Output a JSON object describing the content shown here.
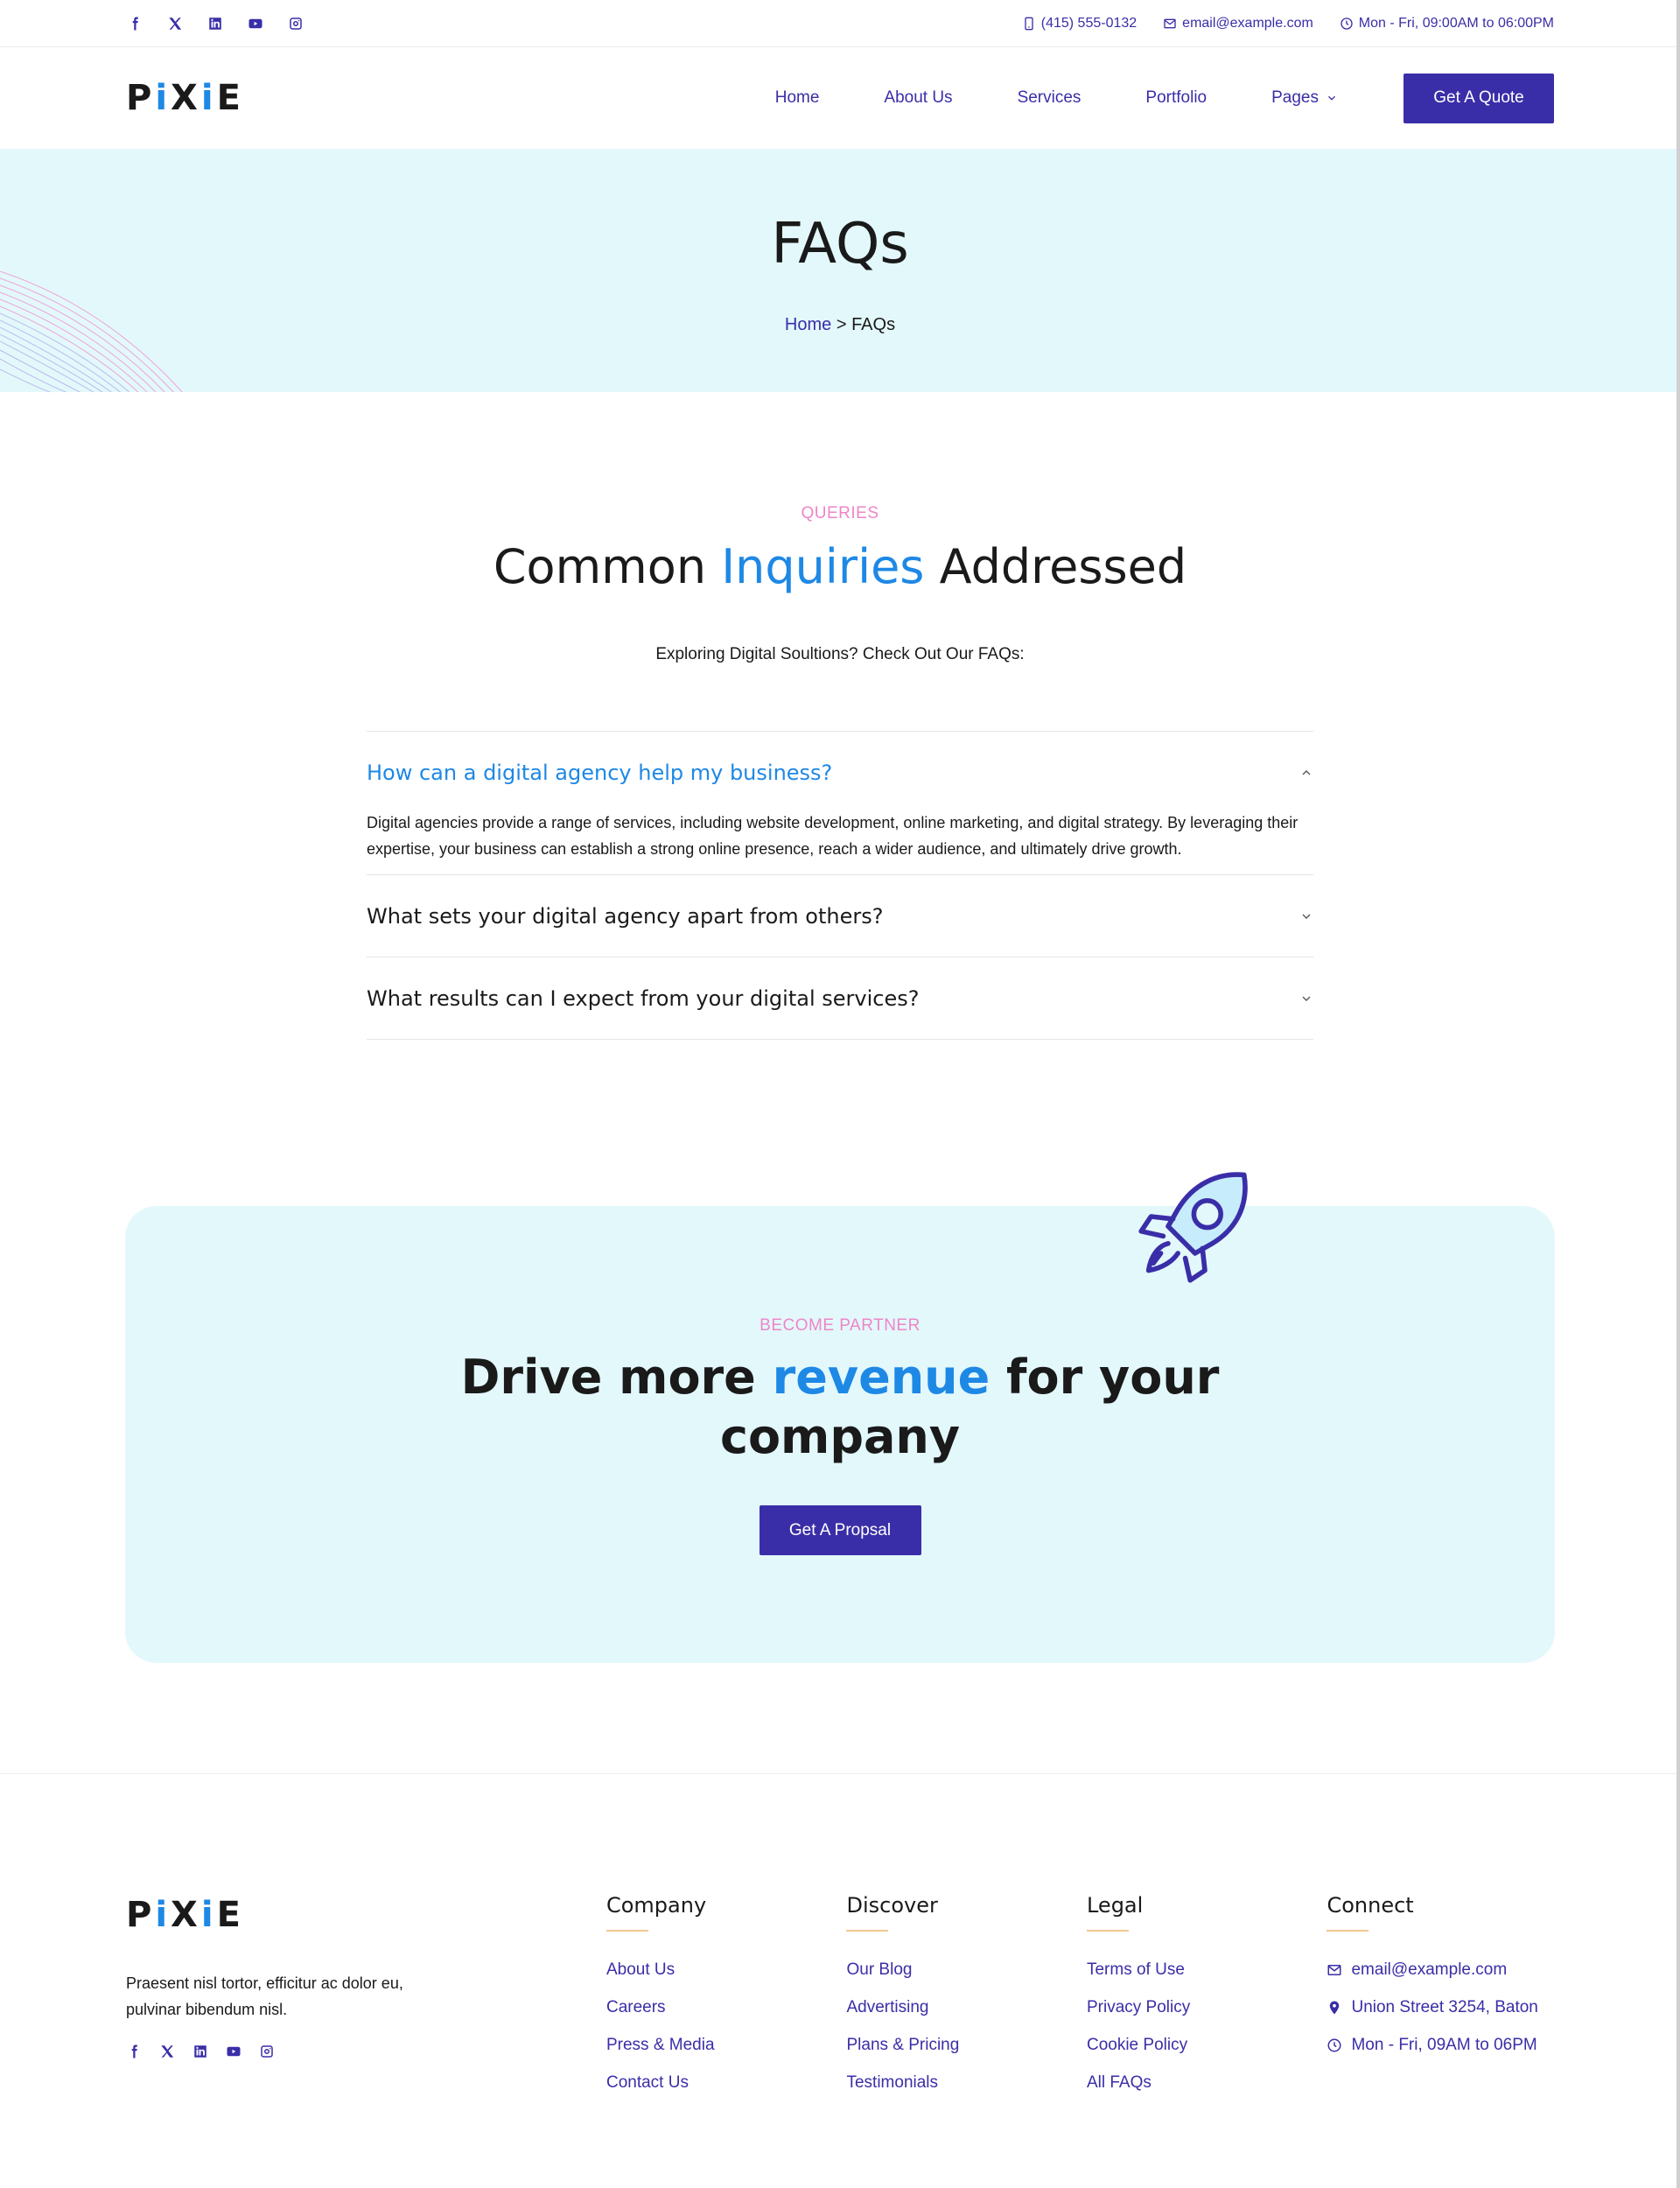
{
  "topbar": {
    "social": [
      "facebook-icon",
      "x-icon",
      "linkedin-icon",
      "youtube-icon",
      "instagram-icon"
    ],
    "phone": "(415) 555-0132",
    "email": "email@example.com",
    "hours": "Mon - Fri, 09:00AM to 06:00PM"
  },
  "header": {
    "logo_pre": "P",
    "logo_i1": "i",
    "logo_mid": "X",
    "logo_i2": "i",
    "logo_post": "E",
    "nav": [
      "Home",
      "About Us",
      "Services",
      "Portfolio",
      "Pages"
    ],
    "cta": "Get A Quote"
  },
  "hero": {
    "title": "FAQs",
    "breadcrumb_home": "Home",
    "breadcrumb_sep": " > ",
    "breadcrumb_current": "FAQs"
  },
  "faq": {
    "eyebrow": "QUERIES",
    "title_pre": "Common ",
    "title_accent": "Inquiries",
    "title_post": " Addressed",
    "subtitle": "Exploring Digital Soultions? Check Out Our FAQs:",
    "items": [
      {
        "question": "How can a digital agency help my business?",
        "answer": "Digital agencies provide a range of services, including website development, online marketing, and digital strategy. By leveraging their expertise, your business can establish a strong online presence, reach a wider audience, and ultimately drive growth.",
        "open": true
      },
      {
        "question": "What sets your digital agency apart from others?",
        "answer": "",
        "open": false
      },
      {
        "question": "What results can I expect from your digital services?",
        "answer": "",
        "open": false
      }
    ]
  },
  "cta": {
    "eyebrow": "BECOME PARTNER",
    "title_pre": "Drive more ",
    "title_accent": "revenue",
    "title_post": " for your",
    "title_line2": "company",
    "button": "Get A Propsal",
    "icon": "rocket-icon"
  },
  "footer": {
    "description": "Praesent nisl tortor, efficitur ac dolor eu, pulvinar bibendum nisl.",
    "columns": [
      {
        "title": "Company",
        "links": [
          "About Us",
          "Careers",
          "Press & Media",
          "Contact Us"
        ]
      },
      {
        "title": "Discover",
        "links": [
          "Our Blog",
          "Advertising",
          "Plans & Pricing",
          "Testimonials"
        ]
      },
      {
        "title": "Legal",
        "links": [
          "Terms of Use",
          "Privacy Policy",
          "Cookie Policy",
          "All FAQs"
        ]
      }
    ],
    "connect": {
      "title": "Connect",
      "email": "email@example.com",
      "address": "Union Street 3254, Baton",
      "hours": "Mon - Fri, 09AM to 06PM"
    }
  },
  "colors": {
    "primary": "#3a2ea8",
    "accent_blue": "#1e88e5",
    "eyebrow_pink": "#ee86c8",
    "hero_bg": "#e3f8fb",
    "underline": "#f5c892"
  }
}
